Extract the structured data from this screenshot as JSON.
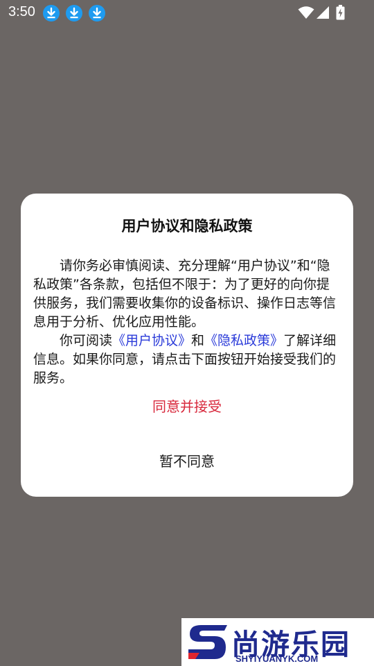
{
  "status_bar": {
    "time": "3:50",
    "notification_icons": [
      "download-icon",
      "download-icon",
      "download-icon"
    ],
    "right_icons": [
      "wifi-icon",
      "signal-icon",
      "battery-charging-icon"
    ]
  },
  "dialog": {
    "title": "用户协议和隐私政策",
    "paragraph1": "请你务必审慎阅读、充分理解“用户协议”和“隐私政策”各条款，包括但不限于：为了更好的向你提供服务，我们需要收集你的设备标识、操作日志等信息用于分析、优化应用性能。",
    "paragraph2_prefix": "你可阅读",
    "user_agreement_link": "《用户协议》",
    "paragraph2_and": "和",
    "privacy_policy_link": "《隐私政策》",
    "paragraph2_suffix": "了解详细信息。如果你同意，请点击下面按钮开始接受我们的服务。",
    "accept_label": "同意并接受",
    "decline_label": "暂不同意",
    "colors": {
      "accept": "#d8283c",
      "link": "#2a3ad9"
    }
  },
  "watermark": {
    "name_cn": "尚游乐园",
    "name_en": "SHYIYUANYK.COM"
  }
}
